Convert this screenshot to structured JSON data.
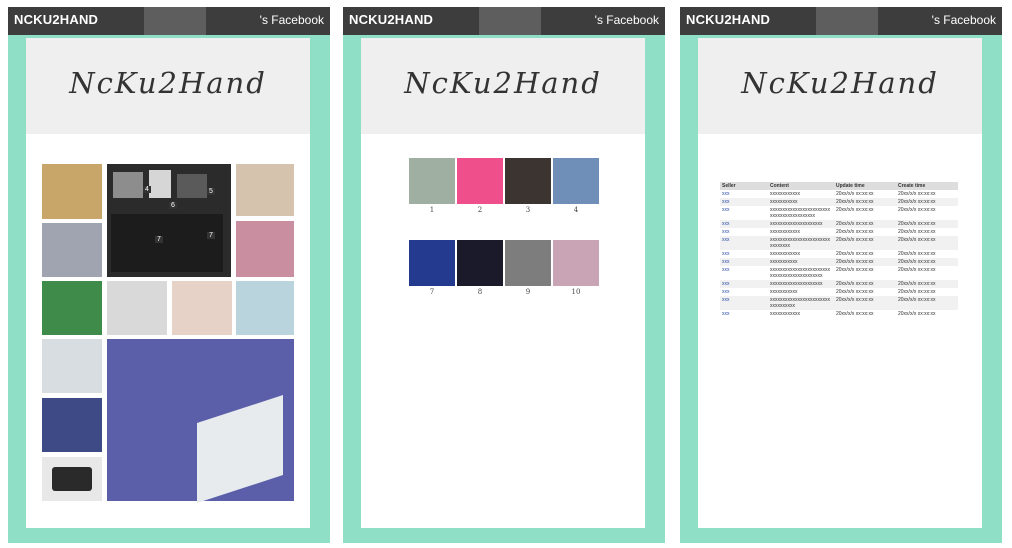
{
  "brand": "NCKU2HAND",
  "facebook": "'s Facebook",
  "logo_text": "NcKu2Hand",
  "panel1": {
    "tags": [
      "4",
      "5",
      "6",
      "7",
      "7"
    ]
  },
  "panel2": {
    "items": [
      {
        "label": "1",
        "color": "#9fb0a3"
      },
      {
        "label": "2",
        "color": "#ef4f8a"
      },
      {
        "label": "3",
        "color": "#3b3430"
      },
      {
        "label": "4",
        "color": "#6f8fb8"
      },
      {
        "label": "7",
        "color": "#233a8f"
      },
      {
        "label": "8",
        "color": "#1a1a2a"
      },
      {
        "label": "9",
        "color": "#7d7d7d"
      },
      {
        "label": "10",
        "color": "#c9a4b4"
      }
    ]
  },
  "panel3": {
    "headers": [
      "Seller",
      "Content",
      "Update time",
      "Create time"
    ],
    "rows": [
      [
        "xxx",
        "xxxxxxxxxxxx",
        "20xx/x/x xx:xx:xx",
        "20xx/x/x xx:xx:xx"
      ],
      [
        "xxx",
        "xxxxxxxxxxx",
        "20xx/x/x xx:xx:xx",
        "20xx/x/x xx:xx:xx"
      ],
      [
        "xxx",
        "xxxxxxxxxxxxxxxxxxxxxxxxxxxxxxxxxxxxxxxxxx",
        "20xx/x/x xx:xx:xx",
        "20xx/x/x xx:xx:xx"
      ],
      [
        "xxx",
        "xxxxxxxxxxxxxxxxxxxxx",
        "20xx/x/x xx:xx:xx",
        "20xx/x/x xx:xx:xx"
      ],
      [
        "xxx",
        "xxxxxxxxxxxx",
        "20xx/x/x xx:xx:xx",
        "20xx/x/x xx:xx:xx"
      ],
      [
        "xxx",
        "xxxxxxxxxxxxxxxxxxxxxxxxxxxxxxxx",
        "20xx/x/x xx:xx:xx",
        "20xx/x/x xx:xx:xx"
      ],
      [
        "xxx",
        "xxxxxxxxxxxx",
        "20xx/x/x xx:xx:xx",
        "20xx/x/x xx:xx:xx"
      ],
      [
        "xxx",
        "xxxxxxxxxxx",
        "20xx/x/x xx:xx:xx",
        "20xx/x/x xx:xx:xx"
      ],
      [
        "xxx",
        "xxxxxxxxxxxxxxxxxxxxxxxxxxxxxxxxxxxxxxxxxxxxx",
        "20xx/x/x xx:xx:xx",
        "20xx/x/x xx:xx:xx"
      ],
      [
        "xxx",
        "xxxxxxxxxxxxxxxxxxxxx",
        "20xx/x/x xx:xx:xx",
        "20xx/x/x xx:xx:xx"
      ],
      [
        "xxx",
        "xxxxxxxxxxx",
        "20xx/x/x xx:xx:xx",
        "20xx/x/x xx:xx:xx"
      ],
      [
        "xxx",
        "xxxxxxxxxxxxxxxxxxxxxxxxxxxxxxxxxx",
        "20xx/x/x xx:xx:xx",
        "20xx/x/x xx:xx:xx"
      ],
      [
        "xxx",
        "xxxxxxxxxxxx",
        "20xx/x/x xx:xx:xx",
        "20xx/x/x xx:xx:xx"
      ]
    ]
  }
}
